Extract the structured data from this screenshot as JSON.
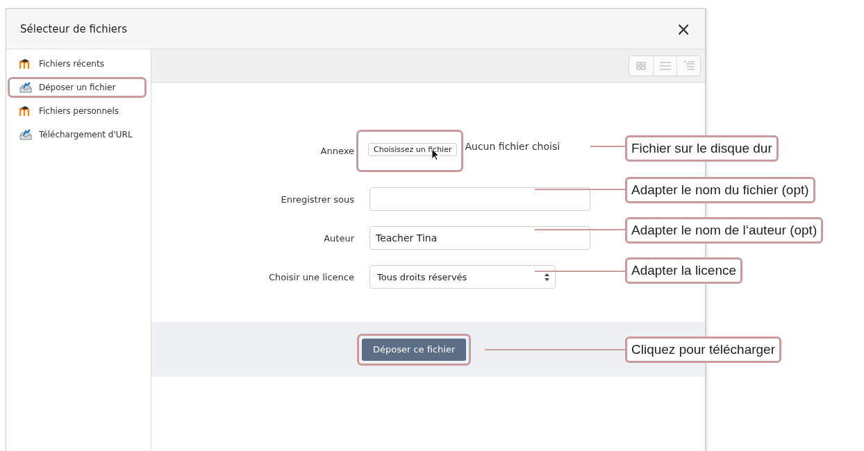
{
  "dialog": {
    "title": "Sélecteur de fichiers",
    "close": "×"
  },
  "sidebar": {
    "items": [
      {
        "label": "Fichiers récents",
        "kind": "repository",
        "selected": false
      },
      {
        "label": "Déposer un fichier",
        "kind": "upload",
        "selected": true
      },
      {
        "label": "Fichiers personnels",
        "kind": "repository",
        "selected": false
      },
      {
        "label": "Téléchargement d'URL",
        "kind": "upload",
        "selected": false
      }
    ]
  },
  "form": {
    "fields": [
      {
        "label": "Annexe",
        "kind": "file",
        "button": "Choisissez un fichier",
        "status": "Aucun fichier choisi",
        "highlighted": true
      },
      {
        "label": "Enregistrer sous",
        "kind": "text"
      },
      {
        "label": "Auteur",
        "kind": "text",
        "value": "Teacher Tina"
      },
      {
        "label": "Choisir une licence",
        "kind": "select",
        "value": "Tous droits réservés"
      }
    ],
    "submit": {
      "label": "Déposer ce fichier",
      "highlighted": true
    }
  },
  "annotations": [
    {
      "text": "Fichier sur le disque dur"
    },
    {
      "text": "Adapter le nom du fichier (opt)"
    },
    {
      "text": "Adapter le nom de l‘auteur (opt)"
    },
    {
      "text": "Adapter la licence"
    },
    {
      "text": "Cliquez pour télécharger"
    }
  ]
}
